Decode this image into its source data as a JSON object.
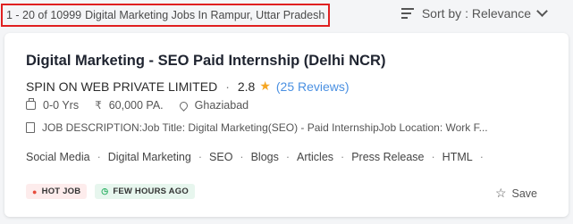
{
  "results": {
    "range": "1 - 20 of 10999",
    "heading": "Digital Marketing Jobs In Rampur, Uttar Pradesh"
  },
  "sort": {
    "label": "Sort by : Relevance",
    "icon": "sort-icon"
  },
  "job": {
    "title": "Digital Marketing - SEO Paid Internship (Delhi NCR)",
    "company": "SPIN ON WEB PRIVATE LIMITED",
    "rating": "2.8",
    "reviews": "(25 Reviews)",
    "experience": "0-0 Yrs",
    "salary": "60,000 PA.",
    "location": "Ghaziabad",
    "description": "JOB DESCRIPTION:Job Title: Digital Marketing(SEO) - Paid InternshipJob Location: Work F...",
    "tags": [
      "Social Media",
      "Digital Marketing",
      "SEO",
      "Blogs",
      "Articles",
      "Press Release",
      "HTML"
    ],
    "badges": {
      "hot": "HOT JOB",
      "fresh": "FEW HOURS AGO"
    },
    "save_label": "Save"
  },
  "colors": {
    "highlight_border": "#e02020",
    "star": "#f5a623",
    "link": "#4a90e2",
    "hot_bg": "#fdecec",
    "fresh_bg": "#e7f6ee"
  }
}
